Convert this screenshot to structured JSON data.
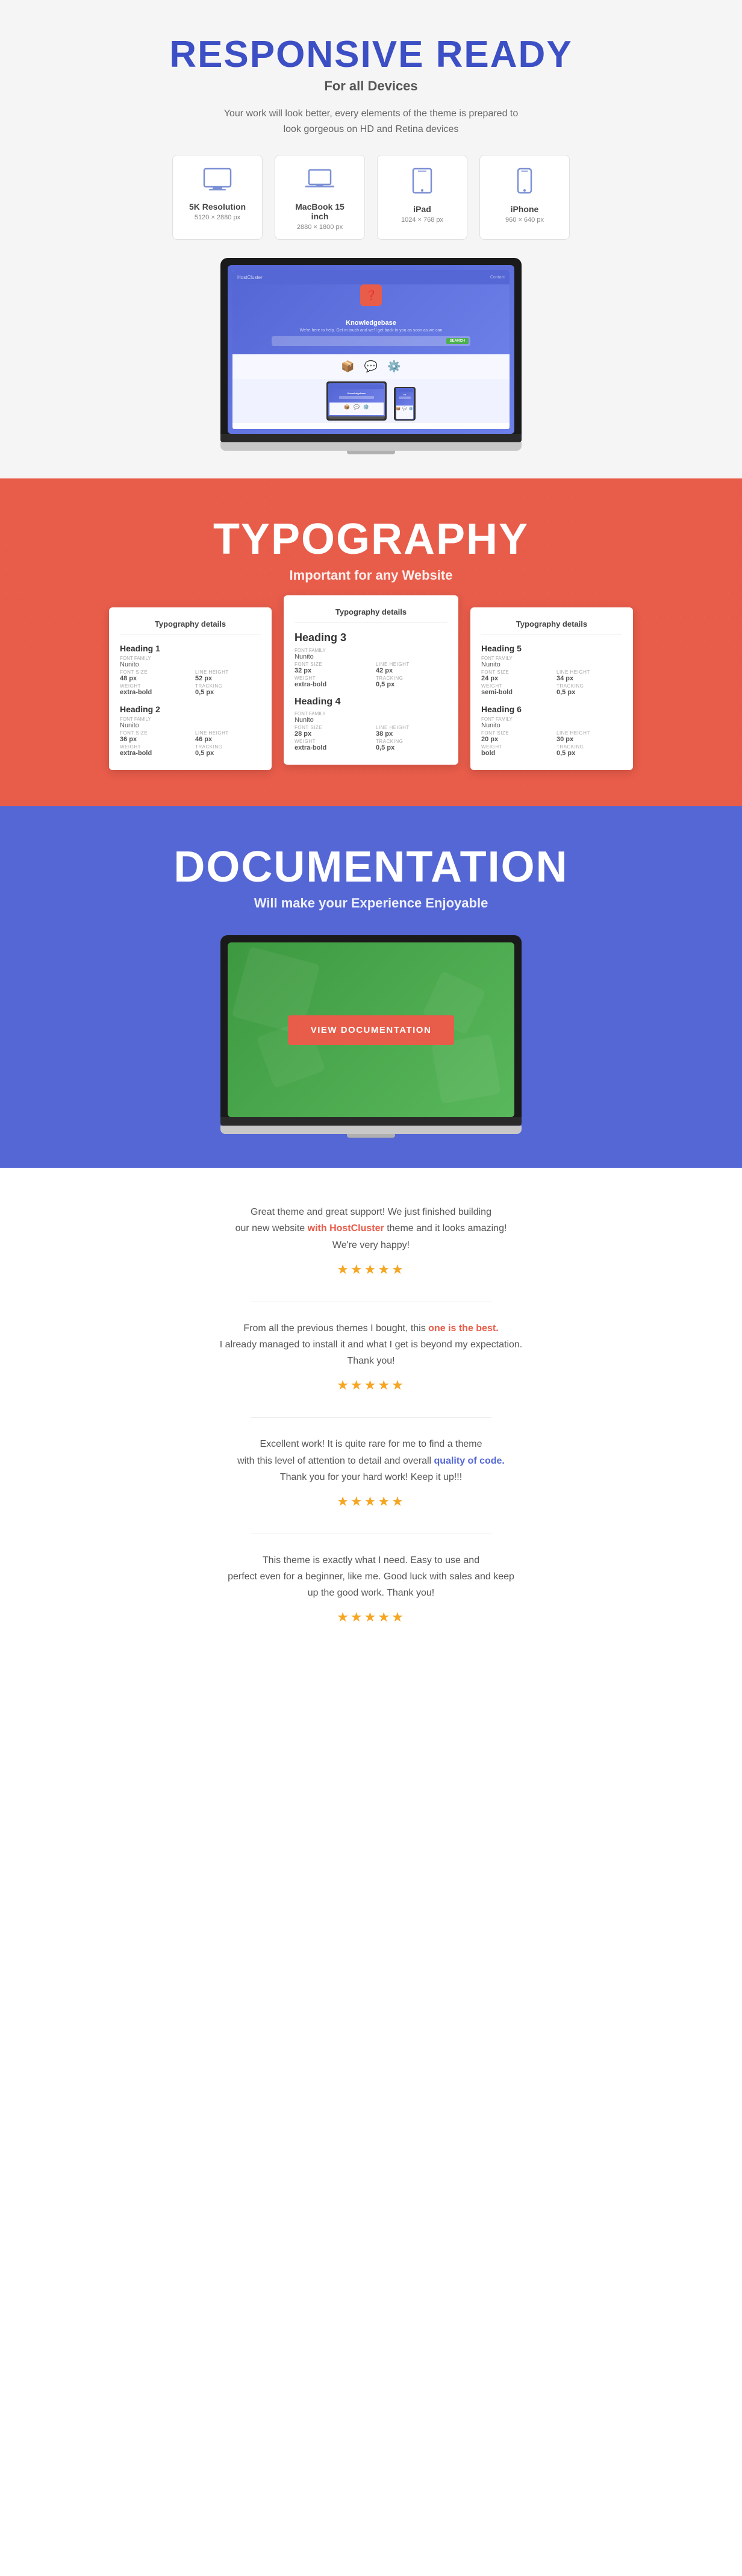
{
  "responsive": {
    "title": "RESPONSIVE READY",
    "subtitle": "For all Devices",
    "description": "Your work will look better, every elements of the theme is prepared to look gorgeous on HD and Retina devices",
    "devices": [
      {
        "name": "5K Resolution",
        "res": "5120 × 2880 px",
        "icon": "🖥"
      },
      {
        "name": "MacBook 15 inch",
        "res": "2880 × 1800 px",
        "icon": "💻"
      },
      {
        "name": "iPad",
        "res": "1024 × 768 px",
        "icon": "📱"
      },
      {
        "name": "iPhone",
        "res": "960 × 640 px",
        "icon": "📱"
      }
    ]
  },
  "typography": {
    "title": "TYPOGRAPHY",
    "subtitle": "Important for any Website",
    "card_title": "Typography details",
    "cards": [
      {
        "title": "Typography details",
        "headings": [
          {
            "label": "Heading 1",
            "font_family_label": "FONT FAMILY",
            "font_family": "Nunito",
            "font_size_label": "FONT SIZE",
            "font_size": "48 px",
            "line_height_label": "LINE HEIGHT",
            "line_height": "52 px",
            "weight_label": "WEIGHT",
            "weight": "extra-bold",
            "tracking_label": "TRACKING",
            "tracking": "0,5 px"
          },
          {
            "label": "Heading 2",
            "font_family_label": "FONT FAMILY",
            "font_family": "Nunito",
            "font_size_label": "FONT SIZE",
            "font_size": "36 px",
            "line_height_label": "LINE HEIGHT",
            "line_height": "46 px",
            "weight_label": "WEIGHT",
            "weight": "extra-bold",
            "tracking_label": "TRACKING",
            "tracking": "0,5 px"
          }
        ]
      },
      {
        "title": "Typography details",
        "headings": [
          {
            "label": "Heading 3",
            "font_family_label": "FONT FAMILY",
            "font_family": "Nunito",
            "font_size_label": "FONT SIZE",
            "font_size": "32 px",
            "line_height_label": "LINE HEIGHT",
            "line_height": "42 px",
            "weight_label": "WEIGHT",
            "weight": "extra-bold",
            "tracking_label": "TRACKING",
            "tracking": "0,5 px"
          },
          {
            "label": "Heading 4",
            "font_family_label": "FONT FAMILY",
            "font_family": "Nunito",
            "font_size_label": "FONT SIZE",
            "font_size": "28 px",
            "line_height_label": "LINE HEIGHT",
            "line_height": "38 px",
            "weight_label": "WEIGHT",
            "weight": "extra-bold",
            "tracking_label": "TRACKING",
            "tracking": "0,5 px"
          }
        ]
      },
      {
        "title": "Typography details",
        "headings": [
          {
            "label": "Heading 5",
            "font_family_label": "FONT FAMILY",
            "font_family": "Nunito",
            "font_size_label": "FONT SIZE",
            "font_size": "24 px",
            "line_height_label": "LINE HEIGHT",
            "line_height": "34 px",
            "weight_label": "WEIGHT",
            "weight": "semi-bold",
            "tracking_label": "TRACKING",
            "tracking": "0,5 px"
          },
          {
            "label": "Heading 6",
            "font_family_label": "FONT FAMILY",
            "font_family": "Nunito",
            "font_size_label": "FONT SIZE",
            "font_size": "20 px",
            "line_height_label": "LINE HEIGHT",
            "line_height": "30 px",
            "weight_label": "WEIGHT",
            "weight": "bold",
            "tracking_label": "TRACKING",
            "tracking": "0,5 px"
          }
        ]
      }
    ]
  },
  "documentation": {
    "title": "DOCUMENTATION",
    "subtitle": "Will make your Experience Enjoyable",
    "button_label": "VIEW DOCUMENTATION"
  },
  "testimonials": [
    {
      "text_parts": [
        {
          "text": "Great theme and great support! We just finished building\nour new website ",
          "highlight": false
        },
        {
          "text": "with HostCluster",
          "highlight": true,
          "color": "red"
        },
        {
          "text": " theme and it looks amazing!\nWe're very happy!",
          "highlight": false
        }
      ],
      "stars": "★★★★★"
    },
    {
      "text_parts": [
        {
          "text": "From all the previous themes I bought, this ",
          "highlight": false
        },
        {
          "text": "one is the best.",
          "highlight": true,
          "color": "red"
        },
        {
          "text": "\nI already managed to install it and what I get is beyond my expectation.\nThank you!",
          "highlight": false
        }
      ],
      "stars": "★★★★★"
    },
    {
      "text_parts": [
        {
          "text": "Excellent work! It is quite rare for me to find a theme\nwith this level of attention to detail and overall ",
          "highlight": false
        },
        {
          "text": "quality of code.",
          "highlight": true,
          "color": "blue"
        },
        {
          "text": "\nThank you for your hard work! Keep it up!!!",
          "highlight": false
        }
      ],
      "stars": "★★★★★"
    },
    {
      "text_parts": [
        {
          "text": "This theme is exactly what I need. Easy to use and\nperfect even for a beginner, like me. Good luck with sales and keep\nup the good work. Thank you!",
          "highlight": false
        }
      ],
      "stars": "★★★★★"
    }
  ]
}
